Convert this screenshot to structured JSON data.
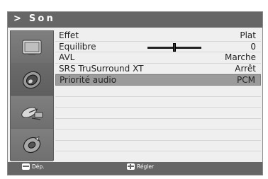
{
  "title": "> Son",
  "sidebar": {
    "items": [
      {
        "icon": "tv-screen-icon"
      },
      {
        "icon": "sound-speaker-icon"
      },
      {
        "icon": "satellite-icon"
      },
      {
        "icon": "settings-disc-icon"
      }
    ],
    "active_index": 1
  },
  "menu": {
    "rows": [
      {
        "label": "Effet",
        "value": "Plat"
      },
      {
        "label": "Equilibre",
        "value": "0"
      },
      {
        "label": "AVL",
        "value": "Marche"
      },
      {
        "label": "SRS TruSurround XT",
        "value": "Arrêt"
      },
      {
        "label": "Priorité audio",
        "value": "PCM"
      }
    ],
    "selected_index": 4,
    "balance_level": 0.5
  },
  "footer": {
    "move_label": "Dép.",
    "adjust_label": "Régler"
  },
  "colors": {
    "title_bar": "#666666",
    "panel": "#efefef",
    "selected_row": "#9b9b9b"
  }
}
